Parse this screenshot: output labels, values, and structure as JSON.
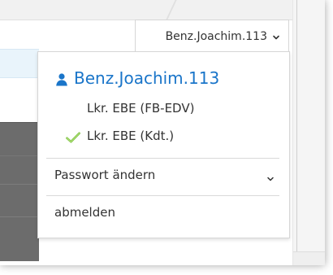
{
  "header": {
    "username": "Benz.Joachim.113"
  },
  "dropdown": {
    "profile_name": "Benz.Joachim.113",
    "roles": [
      {
        "label": "Lkr. EBE (FB-EDV)",
        "checked": false
      },
      {
        "label": "Lkr. EBE (Kdt.)",
        "checked": true
      }
    ],
    "change_password_label": "Passwort ändern",
    "logout_label": "abmelden"
  },
  "icons": {
    "user": "person-icon",
    "chevron": "chevron-down-icon",
    "check": "check-icon"
  },
  "colors": {
    "accent_blue": "#1a75c9",
    "text": "#333333",
    "check_green": "#7bc043",
    "border": "#d6d6d6"
  }
}
